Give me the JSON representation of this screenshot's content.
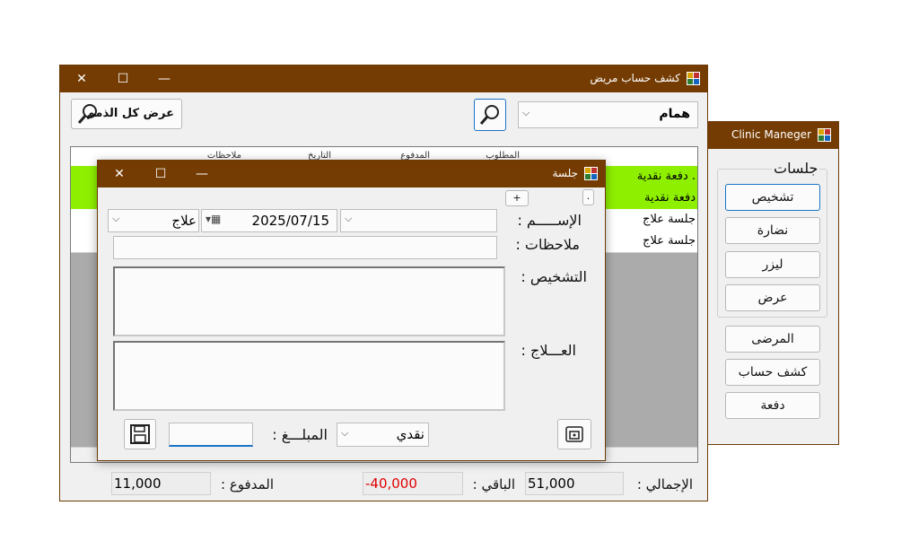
{
  "clinic_window": {
    "title": "Clinic Maneger",
    "group_title": "جلسات",
    "group_buttons": [
      "تشخيص",
      "نضارة",
      "ليزر",
      "عرض"
    ],
    "nav_buttons": [
      "المرضى",
      "كشف حساب",
      "دفعة"
    ]
  },
  "statement_window": {
    "title": "كشف حساب مريض",
    "patient_value": "همام",
    "show_all_button": "عرض كل الذمم",
    "columns": [
      "المطلوب",
      "المدفوع",
      "التاريخ",
      "ملاحظات"
    ],
    "rows": [
      {
        "type": "دفعة نقدية .",
        "highlight": true
      },
      {
        "type": "دفعة نقدية",
        "highlight": true
      },
      {
        "type": "جلسة علاج",
        "highlight": false
      },
      {
        "type": "جلسة علاج",
        "highlight": false
      }
    ],
    "total_label": "الإجمالي :",
    "total_value": "51,000",
    "remaining_label": "الباقي :",
    "remaining_value": "-40,000",
    "paid_label": "المدفوع :",
    "paid_value": "11,000"
  },
  "session_window": {
    "title": "جلسة",
    "plus_label": "+",
    "dot_label": ".",
    "name_label": "الإســـــم :",
    "date_value": "2025/07/15",
    "type_value": "علاج",
    "notes_label": "ملاحظات :",
    "diagnosis_label": "التشخيص :",
    "treatment_label": "العـــلاج :",
    "amount_label": "المبلـــغ :",
    "payment_value": "نقدي"
  },
  "colors": {
    "titlebar": "#743c03",
    "row_highlight": "#8ef000",
    "negative": "#e00000"
  }
}
